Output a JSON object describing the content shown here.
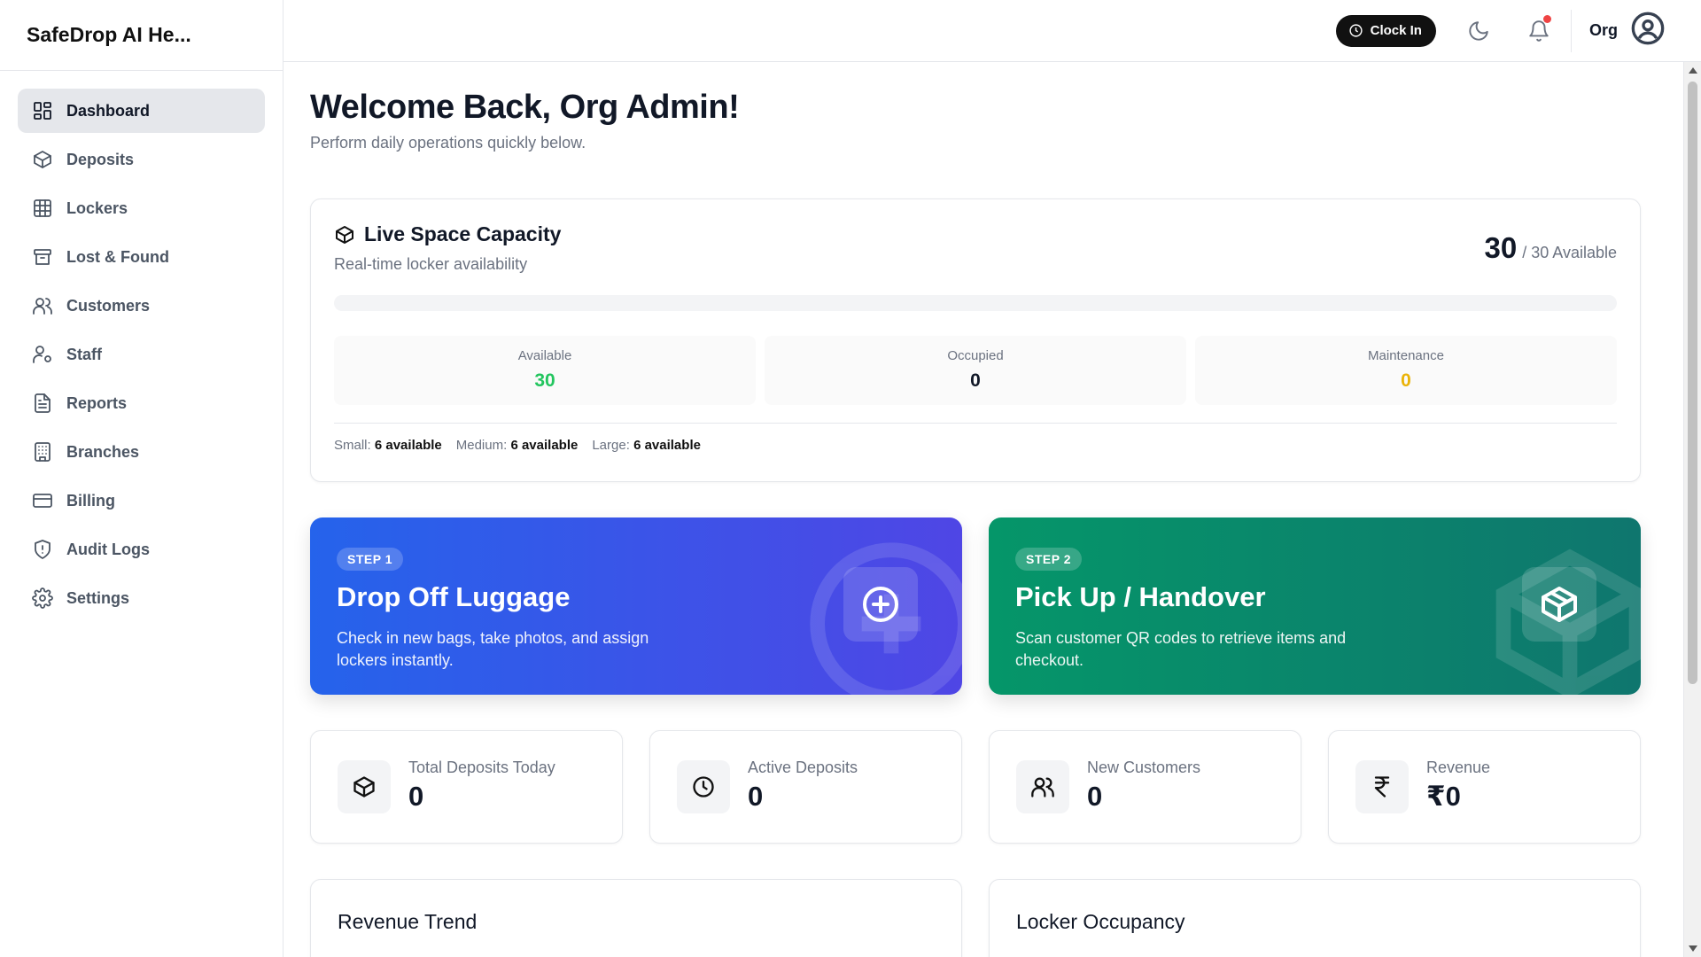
{
  "app": {
    "brand": "SafeDrop AI He..."
  },
  "sidebar": {
    "items": [
      {
        "label": "Dashboard",
        "icon": "dashboard-icon",
        "active": true
      },
      {
        "label": "Deposits",
        "icon": "box-icon"
      },
      {
        "label": "Lockers",
        "icon": "grid-icon"
      },
      {
        "label": "Lost & Found",
        "icon": "archive-icon"
      },
      {
        "label": "Customers",
        "icon": "users-icon"
      },
      {
        "label": "Staff",
        "icon": "user-cog-icon"
      },
      {
        "label": "Reports",
        "icon": "file-icon"
      },
      {
        "label": "Branches",
        "icon": "building-icon"
      },
      {
        "label": "Billing",
        "icon": "credit-card-icon"
      },
      {
        "label": "Audit Logs",
        "icon": "shield-icon"
      },
      {
        "label": "Settings",
        "icon": "gear-icon"
      }
    ]
  },
  "topbar": {
    "clock_in_label": "Clock In",
    "user_name": "Org",
    "notification_dot_color": "#ef4444"
  },
  "main": {
    "welcome": "Welcome Back, Org Admin!",
    "subtitle": "Perform daily operations quickly below."
  },
  "capacity": {
    "title": "Live Space Capacity",
    "subtitle": "Real-time locker availability",
    "available_count": "30",
    "total_label": "/ 30 Available",
    "occupied_fraction": 0,
    "stats": [
      {
        "label": "Available",
        "value": "30",
        "color": "#22c55e"
      },
      {
        "label": "Occupied",
        "value": "0",
        "color": "#111827"
      },
      {
        "label": "Maintenance",
        "value": "0",
        "color": "#eab308"
      }
    ],
    "sizes": [
      {
        "label": "Small:",
        "value": "6 available"
      },
      {
        "label": "Medium:",
        "value": "6 available"
      },
      {
        "label": "Large:",
        "value": "6 available"
      }
    ]
  },
  "actions": [
    {
      "step": "STEP 1",
      "title": "Drop Off Luggage",
      "description": "Check in new bags, take photos, and assign lockers instantly.",
      "color": "#2563eb"
    },
    {
      "step": "STEP 2",
      "title": "Pick Up / Handover",
      "description": "Scan customer QR codes to retrieve items and checkout.",
      "color": "#059669"
    }
  ],
  "kpis": [
    {
      "label": "Total Deposits Today",
      "value": "0",
      "icon": "box-icon"
    },
    {
      "label": "Active Deposits",
      "value": "0",
      "icon": "clock-icon"
    },
    {
      "label": "New Customers",
      "value": "0",
      "icon": "users-icon"
    },
    {
      "label": "Revenue",
      "value": "₹0",
      "icon": "rupee-icon"
    }
  ],
  "charts": [
    {
      "title": "Revenue Trend"
    },
    {
      "title": "Locker Occupancy"
    }
  ]
}
